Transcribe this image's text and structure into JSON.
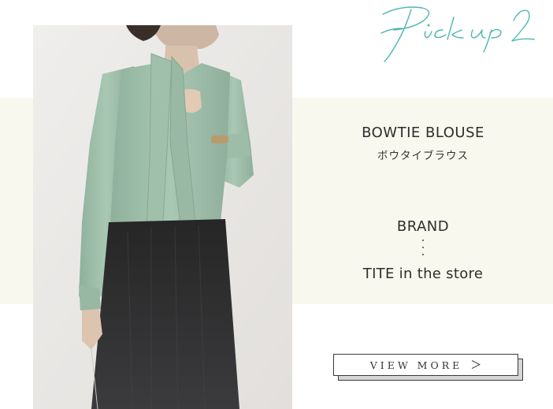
{
  "header": {
    "script_title": "Pick up 2"
  },
  "product": {
    "name_en": "BOWTIE BLOUSE",
    "name_ja": "ボウタイブラウス"
  },
  "brand": {
    "label": "BRAND",
    "separator": "⋮",
    "name": "TITE in the store"
  },
  "actions": {
    "view_more_label": "VIEW MORE",
    "view_more_arrow": "＞"
  },
  "colors": {
    "band_background": "#f8f8ef",
    "script_accent": "#4fb7b0",
    "blouse": "#a3c3ae",
    "skirt": "#2c2c2d"
  }
}
